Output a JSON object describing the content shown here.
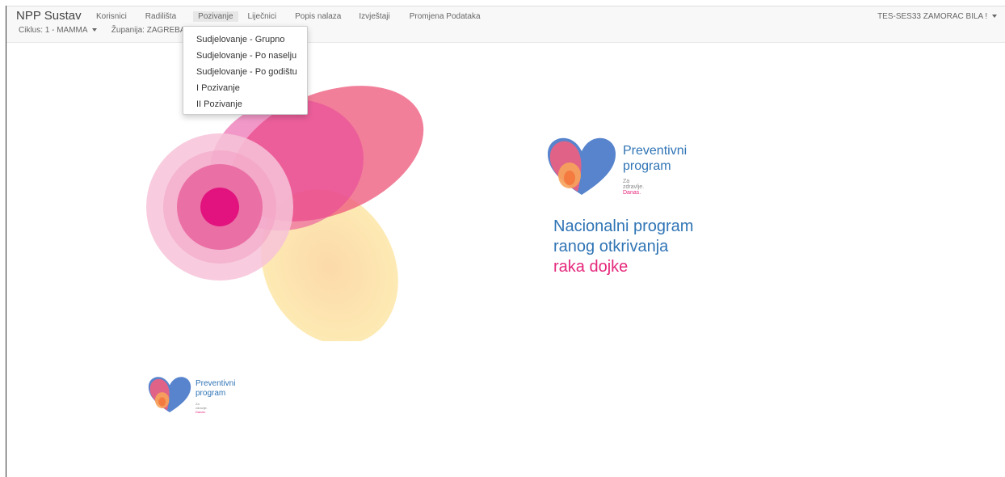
{
  "navbar": {
    "brand": "NPP Sustav",
    "menu": [
      {
        "label": "Korisnici"
      },
      {
        "label": "Radilišta"
      },
      {
        "label": "Pozivanje"
      },
      {
        "label": "Liječnici"
      },
      {
        "label": "Popis nalaza"
      },
      {
        "label": "Izvještaji"
      },
      {
        "label": "Promjena Podataka"
      }
    ],
    "user": "TES-SES33 ZAMORAC BILA !",
    "ciklus": "Ciklus: 1 - MAMMA",
    "zupanija": "Županija: ZAGREBA"
  },
  "dropdown": {
    "items": [
      {
        "label": "Sudjelovanje - Grupno"
      },
      {
        "label": "Sudjelovanje - Po naselju"
      },
      {
        "label": "Sudjelovanje - Po godištu"
      },
      {
        "label": "I Pozivanje"
      },
      {
        "label": "II Pozivanje"
      }
    ]
  },
  "logo": {
    "line1": "Preventivni",
    "line2": "program",
    "tagline_a": "Za zdravlje. ",
    "tagline_b": "Danas."
  },
  "headline": {
    "line1": "Nacionalni program",
    "line2": "ranog otkrivanja",
    "line3": "raka dojke"
  },
  "colors": {
    "blue": "#2f74b5",
    "pink": "#e5277b",
    "yellow": "#fde29a"
  }
}
